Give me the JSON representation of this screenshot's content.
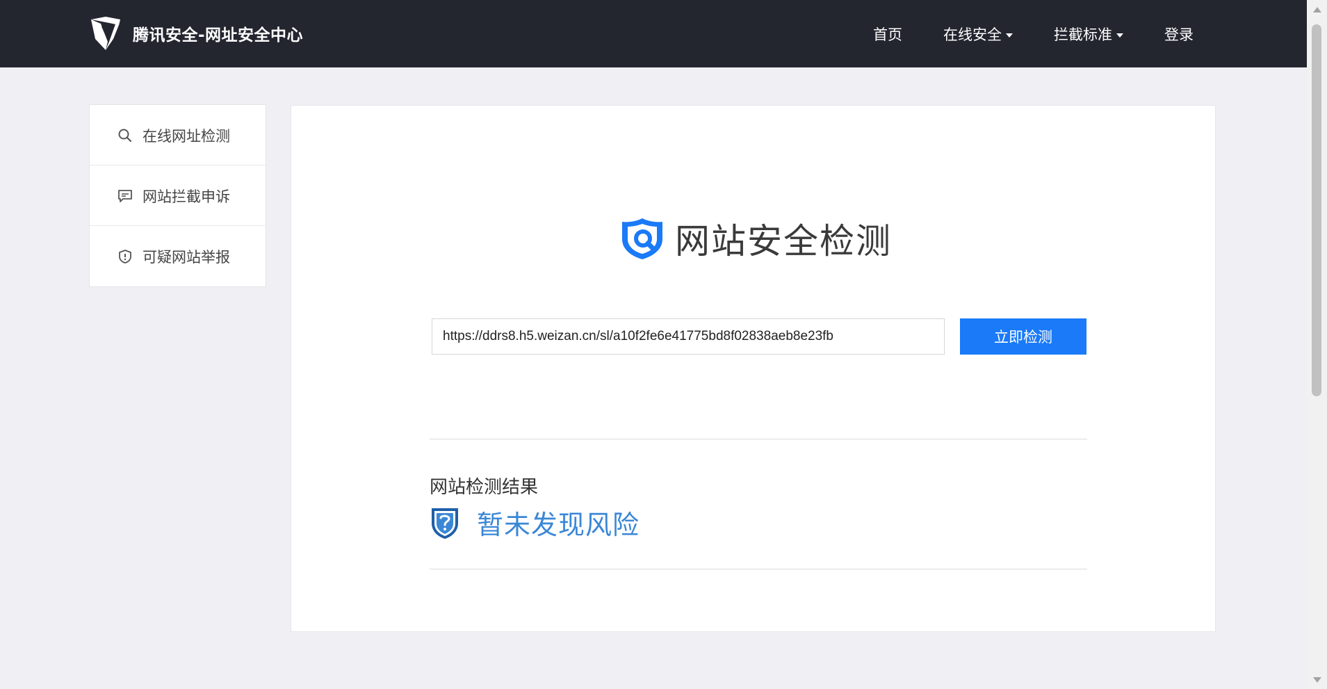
{
  "header": {
    "brand": "腾讯安全-网址安全中心",
    "nav": [
      {
        "label": "首页",
        "has_dropdown": false
      },
      {
        "label": "在线安全",
        "has_dropdown": true
      },
      {
        "label": "拦截标准",
        "has_dropdown": true
      },
      {
        "label": "登录",
        "has_dropdown": false
      }
    ]
  },
  "sidebar": {
    "items": [
      {
        "label": "在线网址检测",
        "icon": "search-icon"
      },
      {
        "label": "网站拦截申诉",
        "icon": "comment-icon"
      },
      {
        "label": "可疑网站举报",
        "icon": "shield-alert-icon"
      }
    ]
  },
  "main": {
    "title": "网站安全检测",
    "url_value": "https://ddrs8.h5.weizan.cn/sl/a10f2fe6e41775bd8f02838aeb8e23fb",
    "check_button": "立即检测",
    "result_heading": "网站检测结果",
    "result_text": "暂未发现风险"
  },
  "colors": {
    "header_bg": "#23252f",
    "accent": "#1a7af8",
    "result_text": "#3a87d6",
    "page_bg": "#f0f0f4"
  }
}
